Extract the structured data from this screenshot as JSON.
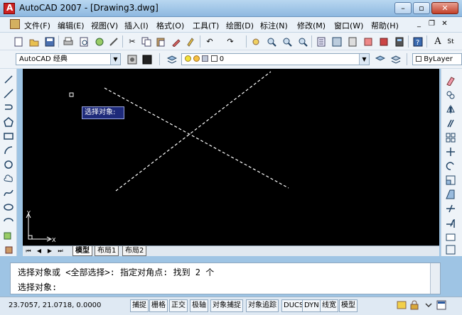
{
  "window": {
    "title": "AutoCAD 2007 - [Drawing3.dwg]"
  },
  "menu": [
    "文件(F)",
    "编辑(E)",
    "视图(V)",
    "插入(I)",
    "格式(O)",
    "工具(T)",
    "绘图(D)",
    "标注(N)",
    "修改(M)",
    "窗口(W)",
    "帮助(H)"
  ],
  "workspace": {
    "value": "AutoCAD 经典"
  },
  "layer": {
    "value": "0"
  },
  "properties": {
    "color": "ByLayer"
  },
  "canvas": {
    "tooltip": "选择对象:",
    "ucs_x": "X",
    "ucs_y": "Y"
  },
  "layout_tabs": [
    "模型",
    "布局1",
    "布局2"
  ],
  "command": {
    "line1": "选择对象或 <全部选择>:  指定对角点: 找到 2 个",
    "line2": "选择对象:"
  },
  "status": {
    "coords": "23.7057, 21.0718, 0.0000",
    "toggles": [
      "捕捉",
      "栅格",
      "正交",
      "极轴",
      "对象捕捉",
      "对象追踪",
      "DUCS",
      "DYN",
      "线宽",
      "模型"
    ]
  }
}
